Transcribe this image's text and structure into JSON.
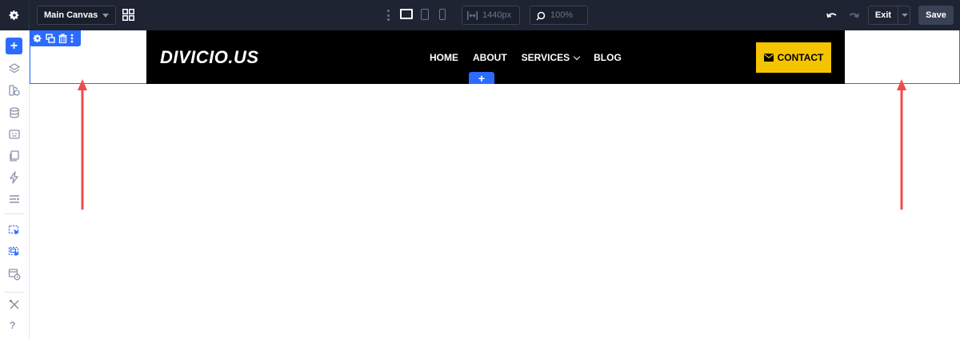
{
  "topbar": {
    "canvas_select": "Main Canvas",
    "width_value": "1440px",
    "zoom_value": "100%",
    "exit_label": "Exit",
    "save_label": "Save"
  },
  "header": {
    "logo_text": "DIVICIO.US",
    "nav": [
      "HOME",
      "ABOUT",
      "SERVICES",
      "BLOG"
    ],
    "contact_label": "CONTACT"
  },
  "row_add_label": "+",
  "sidebar": {
    "add_label": "+",
    "help_label": "?"
  },
  "colors": {
    "topbar_bg": "#1f2433",
    "accent_blue": "#2b6bff",
    "header_bg": "#000000",
    "contact_bg": "#f5c400",
    "arrow": "#f04b4b"
  }
}
